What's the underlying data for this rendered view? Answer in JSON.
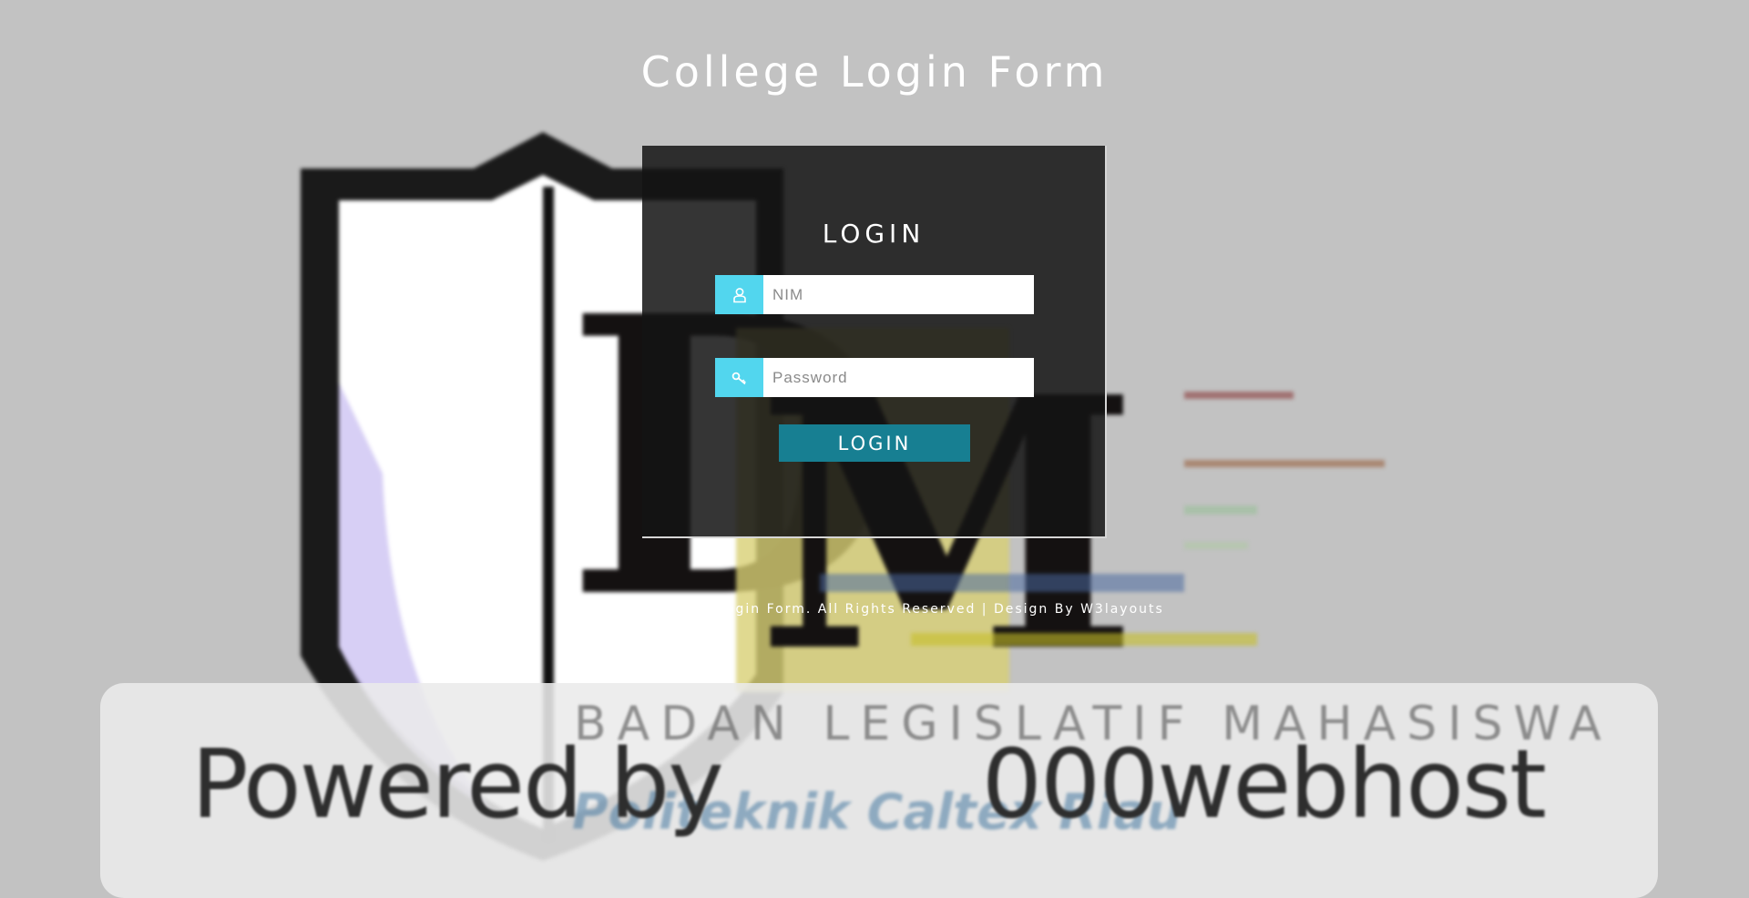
{
  "page": {
    "title": "College Login Form"
  },
  "login": {
    "heading": "LOGIN",
    "nim_placeholder": "NIM",
    "password_placeholder": "Password",
    "button_label": "LOGIN",
    "user_icon": "user-icon",
    "key_icon": "key-icon"
  },
  "footer": {
    "text": "© 2017 College Login Form. All Rights Reserved | Design By W3layouts"
  },
  "background": {
    "logo_letters": "DM",
    "organization": "BADAN LEGISLATIF MAHASISWA",
    "organization_sub": "Politeknik Caltex Riau",
    "banner": {
      "powered_by": "Powered by",
      "host": "000webhost"
    }
  },
  "colors": {
    "background": "#c2c2c2",
    "panel": "#141414",
    "icon_box": "#52d6ee",
    "button": "#177f92"
  }
}
